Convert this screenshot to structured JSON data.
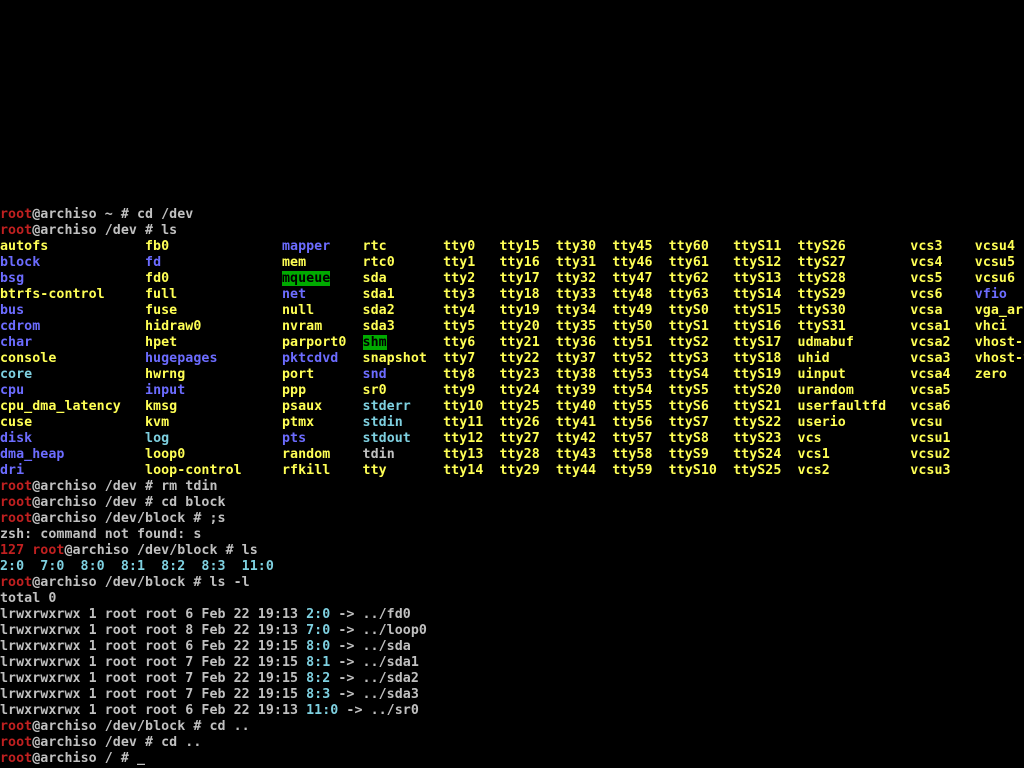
{
  "colors": {
    "background": "#000000",
    "white": "#c0c0c0",
    "red": "#c02020",
    "blue": "#6c6cff",
    "cyan": "#7ed0e0",
    "yellow": "#ffff55",
    "green_bg": "#00aa00"
  },
  "terminal": {
    "lines": [
      [
        {
          "t": "root",
          "c": "red"
        },
        {
          "t": "@archiso ~ # cd /dev",
          "c": "white"
        }
      ],
      [
        {
          "t": "root",
          "c": "red"
        },
        {
          "t": "@archiso /dev # ls",
          "c": "white"
        }
      ],
      [
        {
          "t": "autofs            ",
          "c": "yellow"
        },
        {
          "t": "fb0              ",
          "c": "yellow"
        },
        {
          "t": "mapper",
          "c": "blue"
        },
        {
          "t": "    ",
          "c": "white"
        },
        {
          "t": "rtc       ",
          "c": "yellow"
        },
        {
          "t": "tty0   tty15  tty30  tty45  tty60   ttyS11  ttyS26        vcs3    vcsu4",
          "c": "yellow"
        }
      ],
      [
        {
          "t": "block",
          "c": "blue"
        },
        {
          "t": "             ",
          "c": "white"
        },
        {
          "t": "fd",
          "c": "blue"
        },
        {
          "t": "               ",
          "c": "white"
        },
        {
          "t": "mem       ",
          "c": "yellow"
        },
        {
          "t": "rtc0      ",
          "c": "yellow"
        },
        {
          "t": "tty1   tty16  tty31  tty46  tty61   ttyS12  ttyS27        vcs4    vcsu5",
          "c": "yellow"
        }
      ],
      [
        {
          "t": "bsg",
          "c": "blue"
        },
        {
          "t": "               ",
          "c": "white"
        },
        {
          "t": "fd0              ",
          "c": "yellow"
        },
        {
          "t": "mqueue",
          "c": "blue",
          "bg": "green_bg"
        },
        {
          "t": "    ",
          "c": "white"
        },
        {
          "t": "sda       ",
          "c": "yellow"
        },
        {
          "t": "tty2   tty17  tty32  tty47  tty62   ttyS13  ttyS28        vcs5    vcsu6",
          "c": "yellow"
        }
      ],
      [
        {
          "t": "btrfs-control     ",
          "c": "yellow"
        },
        {
          "t": "full             ",
          "c": "yellow"
        },
        {
          "t": "net",
          "c": "blue"
        },
        {
          "t": "       ",
          "c": "white"
        },
        {
          "t": "sda1      ",
          "c": "yellow"
        },
        {
          "t": "tty3   tty18  tty33  tty48  tty63   ttyS14  ttyS29        vcs6    ",
          "c": "yellow"
        },
        {
          "t": "vfio",
          "c": "blue"
        }
      ],
      [
        {
          "t": "bus",
          "c": "blue"
        },
        {
          "t": "               ",
          "c": "white"
        },
        {
          "t": "fuse             ",
          "c": "yellow"
        },
        {
          "t": "null      ",
          "c": "yellow"
        },
        {
          "t": "sda2      ",
          "c": "yellow"
        },
        {
          "t": "tty4   tty19  tty34  tty49  ttyS0   ttyS15  ttyS30        vcsa    vga_arbiter",
          "c": "yellow"
        }
      ],
      [
        {
          "t": "cdrom",
          "c": "blue"
        },
        {
          "t": "             ",
          "c": "white"
        },
        {
          "t": "hidraw0          ",
          "c": "yellow"
        },
        {
          "t": "nvram     ",
          "c": "yellow"
        },
        {
          "t": "sda3      ",
          "c": "yellow"
        },
        {
          "t": "tty5   tty20  tty35  tty50  ttyS1   ttyS16  ttyS31        vcsa1   vhci",
          "c": "yellow"
        }
      ],
      [
        {
          "t": "char",
          "c": "blue"
        },
        {
          "t": "              ",
          "c": "white"
        },
        {
          "t": "hpet             ",
          "c": "yellow"
        },
        {
          "t": "parport0  ",
          "c": "yellow"
        },
        {
          "t": "shm",
          "c": "blue",
          "bg": "green_bg"
        },
        {
          "t": "       ",
          "c": "white"
        },
        {
          "t": "tty6   tty21  tty36  tty51  ttyS2   ttyS17  udmabuf       vcsa2   vhost-net",
          "c": "yellow"
        }
      ],
      [
        {
          "t": "console           ",
          "c": "yellow"
        },
        {
          "t": "hugepages",
          "c": "blue"
        },
        {
          "t": "        ",
          "c": "white"
        },
        {
          "t": "pktcdvd",
          "c": "blue"
        },
        {
          "t": "   ",
          "c": "white"
        },
        {
          "t": "snapshot  ",
          "c": "yellow"
        },
        {
          "t": "tty7   tty22  tty37  tty52  ttyS3   ttyS18  uhid          vcsa3   vhost-vsock",
          "c": "yellow"
        }
      ],
      [
        {
          "t": "core",
          "c": "cyan"
        },
        {
          "t": "              ",
          "c": "white"
        },
        {
          "t": "hwrng            ",
          "c": "yellow"
        },
        {
          "t": "port      ",
          "c": "yellow"
        },
        {
          "t": "snd",
          "c": "blue"
        },
        {
          "t": "       ",
          "c": "white"
        },
        {
          "t": "tty8   tty23  tty38  tty53  ttyS4   ttyS19  uinput        vcsa4   zero",
          "c": "yellow"
        }
      ],
      [
        {
          "t": "cpu",
          "c": "blue"
        },
        {
          "t": "               ",
          "c": "white"
        },
        {
          "t": "input",
          "c": "blue"
        },
        {
          "t": "            ",
          "c": "white"
        },
        {
          "t": "ppp       ",
          "c": "yellow"
        },
        {
          "t": "sr0       ",
          "c": "yellow"
        },
        {
          "t": "tty9   tty24  tty39  tty54  ttyS5   ttyS20  urandom       vcsa5",
          "c": "yellow"
        }
      ],
      [
        {
          "t": "cpu_dma_latency   ",
          "c": "yellow"
        },
        {
          "t": "kmsg             ",
          "c": "yellow"
        },
        {
          "t": "psaux     ",
          "c": "yellow"
        },
        {
          "t": "stderr",
          "c": "cyan"
        },
        {
          "t": "    ",
          "c": "white"
        },
        {
          "t": "tty10  tty25  tty40  tty55  ttyS6   ttyS21  userfaultfd   vcsa6",
          "c": "yellow"
        }
      ],
      [
        {
          "t": "cuse              ",
          "c": "yellow"
        },
        {
          "t": "kvm              ",
          "c": "yellow"
        },
        {
          "t": "ptmx      ",
          "c": "yellow"
        },
        {
          "t": "stdin",
          "c": "cyan"
        },
        {
          "t": "     ",
          "c": "white"
        },
        {
          "t": "tty11  tty26  tty41  tty56  ttyS7   ttyS22  userio        vcsu",
          "c": "yellow"
        }
      ],
      [
        {
          "t": "disk",
          "c": "blue"
        },
        {
          "t": "              ",
          "c": "white"
        },
        {
          "t": "log",
          "c": "cyan"
        },
        {
          "t": "              ",
          "c": "white"
        },
        {
          "t": "pts",
          "c": "blue"
        },
        {
          "t": "       ",
          "c": "white"
        },
        {
          "t": "stdout",
          "c": "cyan"
        },
        {
          "t": "    ",
          "c": "white"
        },
        {
          "t": "tty12  tty27  tty42  tty57  ttyS8   ttyS23  vcs           vcsu1",
          "c": "yellow"
        }
      ],
      [
        {
          "t": "dma_heap",
          "c": "blue"
        },
        {
          "t": "          ",
          "c": "white"
        },
        {
          "t": "loop0            ",
          "c": "yellow"
        },
        {
          "t": "random    ",
          "c": "yellow"
        },
        {
          "t": "tdin      ",
          "c": "white"
        },
        {
          "t": "tty13  tty28  tty43  tty58  ttyS9   ttyS24  vcs1          vcsu2",
          "c": "yellow"
        }
      ],
      [
        {
          "t": "dri",
          "c": "blue"
        },
        {
          "t": "               ",
          "c": "white"
        },
        {
          "t": "loop-control     ",
          "c": "yellow"
        },
        {
          "t": "rfkill    ",
          "c": "yellow"
        },
        {
          "t": "tty       ",
          "c": "yellow"
        },
        {
          "t": "tty14  tty29  tty44  tty59  ttyS10  ttyS25  vcs2          vcsu3",
          "c": "yellow"
        }
      ],
      [
        {
          "t": "root",
          "c": "red"
        },
        {
          "t": "@archiso /dev # rm tdin",
          "c": "white"
        }
      ],
      [
        {
          "t": "root",
          "c": "red"
        },
        {
          "t": "@archiso /dev # cd block",
          "c": "white"
        }
      ],
      [
        {
          "t": "root",
          "c": "red"
        },
        {
          "t": "@archiso /dev/block # ;s",
          "c": "white"
        }
      ],
      [
        {
          "t": "zsh: command not found: s",
          "c": "white"
        }
      ],
      [
        {
          "t": "127",
          "c": "red"
        },
        {
          "t": " ",
          "c": "white"
        },
        {
          "t": "root",
          "c": "red"
        },
        {
          "t": "@archiso /dev/block # ls",
          "c": "white"
        }
      ],
      [
        {
          "t": "2:0  7:0  8:0  8:1  8:2  8:3  11:0",
          "c": "cyan"
        }
      ],
      [
        {
          "t": "root",
          "c": "red"
        },
        {
          "t": "@archiso /dev/block # ls -l",
          "c": "white"
        }
      ],
      [
        {
          "t": "total 0",
          "c": "white"
        }
      ],
      [
        {
          "t": "lrwxrwxrwx 1 root root 6 Feb 22 19:13 ",
          "c": "white"
        },
        {
          "t": "2:0",
          "c": "cyan"
        },
        {
          "t": " -> ../fd0",
          "c": "white"
        }
      ],
      [
        {
          "t": "lrwxrwxrwx 1 root root 8 Feb 22 19:13 ",
          "c": "white"
        },
        {
          "t": "7:0",
          "c": "cyan"
        },
        {
          "t": " -> ../loop0",
          "c": "white"
        }
      ],
      [
        {
          "t": "lrwxrwxrwx 1 root root 6 Feb 22 19:15 ",
          "c": "white"
        },
        {
          "t": "8:0",
          "c": "cyan"
        },
        {
          "t": " -> ../sda",
          "c": "white"
        }
      ],
      [
        {
          "t": "lrwxrwxrwx 1 root root 7 Feb 22 19:15 ",
          "c": "white"
        },
        {
          "t": "8:1",
          "c": "cyan"
        },
        {
          "t": " -> ../sda1",
          "c": "white"
        }
      ],
      [
        {
          "t": "lrwxrwxrwx 1 root root 7 Feb 22 19:15 ",
          "c": "white"
        },
        {
          "t": "8:2",
          "c": "cyan"
        },
        {
          "t": " -> ../sda2",
          "c": "white"
        }
      ],
      [
        {
          "t": "lrwxrwxrwx 1 root root 7 Feb 22 19:15 ",
          "c": "white"
        },
        {
          "t": "8:3",
          "c": "cyan"
        },
        {
          "t": " -> ../sda3",
          "c": "white"
        }
      ],
      [
        {
          "t": "lrwxrwxrwx 1 root root 6 Feb 22 19:13 ",
          "c": "white"
        },
        {
          "t": "11:0",
          "c": "cyan"
        },
        {
          "t": " -> ../sr0",
          "c": "white"
        }
      ],
      [
        {
          "t": "root",
          "c": "red"
        },
        {
          "t": "@archiso /dev/block # cd ..",
          "c": "white"
        }
      ],
      [
        {
          "t": "root",
          "c": "red"
        },
        {
          "t": "@archiso /dev # cd ..",
          "c": "white"
        }
      ],
      [
        {
          "t": "root",
          "c": "red"
        },
        {
          "t": "@archiso / # ",
          "c": "white"
        }
      ]
    ],
    "cursor": "_"
  }
}
